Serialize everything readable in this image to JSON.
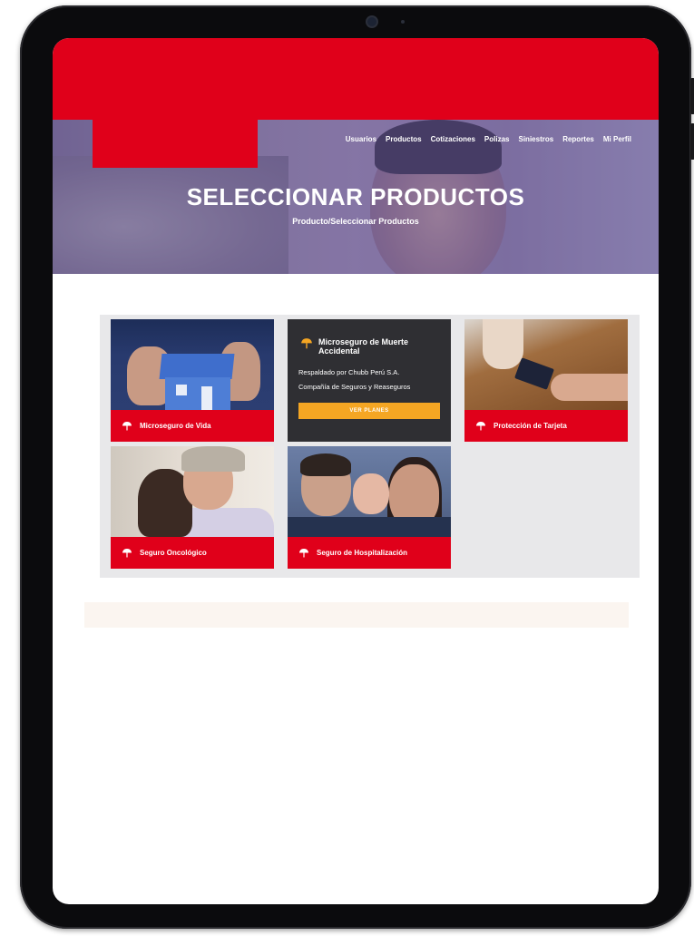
{
  "colors": {
    "brand_red": "#e0001a",
    "button_orange": "#f5a623",
    "panel_gray": "#e8e8ea"
  },
  "nav": {
    "items": [
      "Usuarios",
      "Productos",
      "Cotizaciones",
      "Polizas",
      "Siniestros",
      "Reportes",
      "Mi Perfil"
    ]
  },
  "hero": {
    "title": "SELECCIONAR PRODUCTOS",
    "breadcrumb": "Producto/Seleccionar Productos"
  },
  "products": {
    "vida": {
      "label": "Microseguro de Vida",
      "icon": "umbrella-icon"
    },
    "muerte": {
      "title": "Microseguro de Muerte Accidental",
      "line1": "Respaldado por Chubb Perú S.A.",
      "line2": "Compañía de Seguros y Reaseguros",
      "button": "VER PLANES",
      "icon": "umbrella-icon"
    },
    "tarjeta": {
      "label": "Protección de Tarjeta",
      "icon": "umbrella-icon"
    },
    "oncologico": {
      "label": "Seguro Oncológico",
      "icon": "umbrella-icon"
    },
    "hospitalizacion": {
      "label": "Seguro de Hospitalización",
      "icon": "umbrella-icon"
    }
  }
}
